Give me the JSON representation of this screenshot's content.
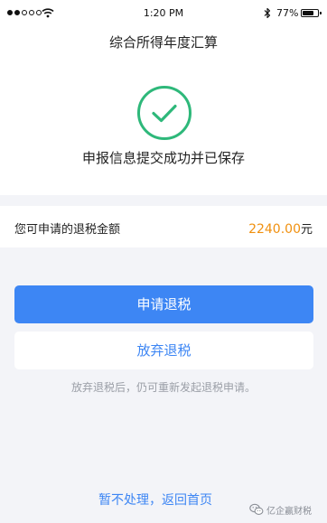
{
  "status_bar": {
    "time": "1:20 PM",
    "battery_percent_label": "77%",
    "battery_level": 0.77,
    "signal_bars_filled": 2,
    "signal_bars_total": 5,
    "icons": [
      "signal-icon",
      "wifi-icon",
      "bluetooth-icon",
      "battery-icon"
    ]
  },
  "header": {
    "title": "综合所得年度汇算"
  },
  "result": {
    "icon": "check-circle-icon",
    "message": "申报信息提交成功并已保存"
  },
  "refund": {
    "label": "您可申请的退税金额",
    "amount": "2240.00",
    "unit": "元"
  },
  "actions": {
    "apply_label": "申请退税",
    "abandon_label": "放弃退税",
    "hint": "放弃退税后，仍可重新发起退税申请。",
    "back_label": "暂不处理，返回首页"
  },
  "watermark": {
    "text": "亿企赢财税",
    "icon": "wechat-logo-icon"
  },
  "colors": {
    "accent": "#3d86f4",
    "success": "#2eb87a",
    "amount": "#f0900f",
    "page_bg": "#f3f4f8"
  }
}
